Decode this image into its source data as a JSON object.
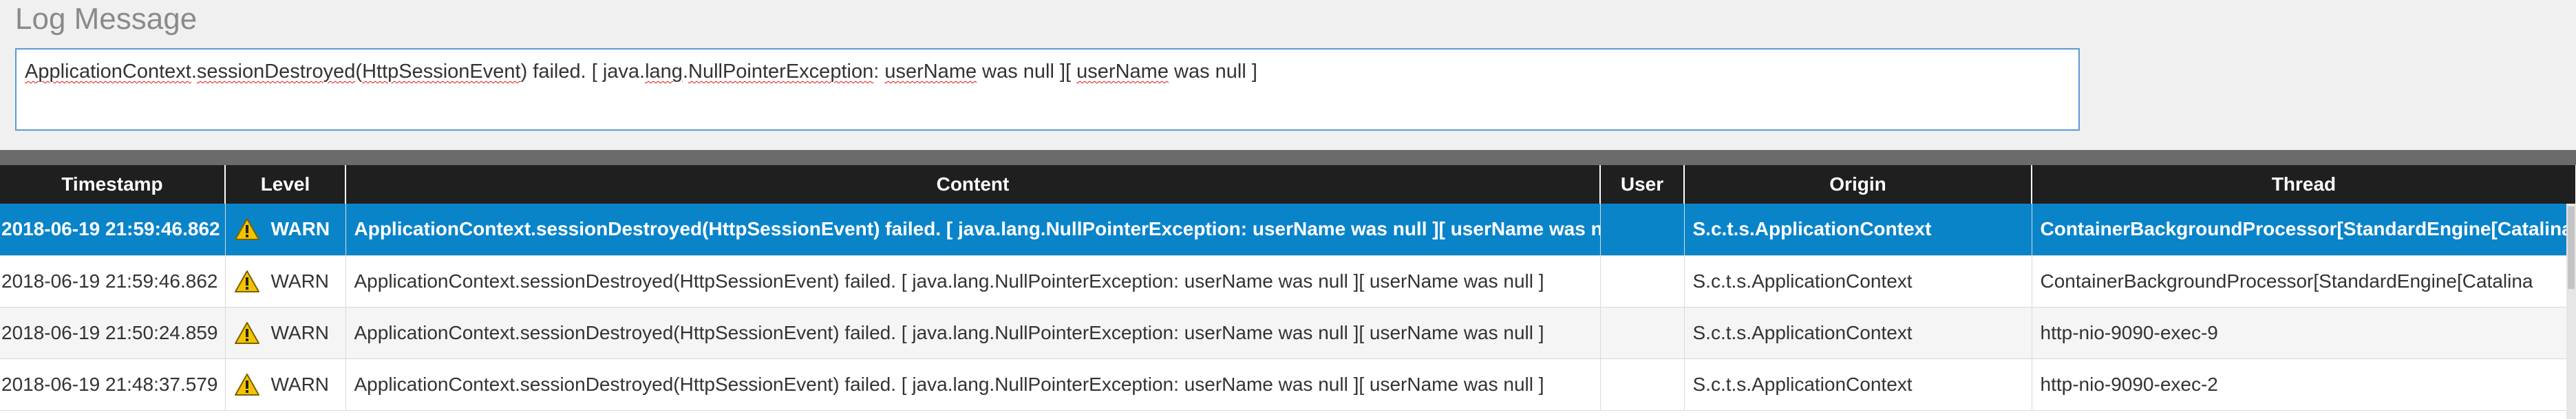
{
  "log_message": {
    "title": "Log Message",
    "text_parts": [
      {
        "t": "ApplicationContext",
        "sq": true
      },
      {
        "t": ".",
        "sq": false
      },
      {
        "t": "sessionDestroyed",
        "sq": true
      },
      {
        "t": "(",
        "sq": false
      },
      {
        "t": "HttpSessionEvent",
        "sq": true
      },
      {
        "t": ") failed. [ java.",
        "sq": false
      },
      {
        "t": "lang",
        "sq": true
      },
      {
        "t": ".",
        "sq": false
      },
      {
        "t": "NullPointerException",
        "sq": true
      },
      {
        "t": ": ",
        "sq": false
      },
      {
        "t": "userName",
        "sq": true
      },
      {
        "t": " was null ][ ",
        "sq": false
      },
      {
        "t": "userName",
        "sq": true
      },
      {
        "t": " was null ]",
        "sq": false
      }
    ]
  },
  "grid": {
    "columns": [
      "Timestamp",
      "Level",
      "Content",
      "User",
      "Origin",
      "Thread"
    ],
    "rows": [
      {
        "timestamp": "2018-06-19 21:59:46.862",
        "level": "WARN",
        "icon": "warning-icon",
        "content": "ApplicationContext.sessionDestroyed(HttpSessionEvent) failed. [ java.lang.NullPointerException: userName was null ][ userName was null ]",
        "user": "",
        "origin": "S.c.t.s.ApplicationContext",
        "thread": "ContainerBackgroundProcessor[StandardEngine[Catalina",
        "selected": true
      },
      {
        "timestamp": "2018-06-19 21:59:46.862",
        "level": "WARN",
        "icon": "warning-icon",
        "content": "ApplicationContext.sessionDestroyed(HttpSessionEvent) failed. [ java.lang.NullPointerException: userName was null ][ userName was null ]",
        "user": "",
        "origin": "S.c.t.s.ApplicationContext",
        "thread": "ContainerBackgroundProcessor[StandardEngine[Catalina",
        "selected": false
      },
      {
        "timestamp": "2018-06-19 21:50:24.859",
        "level": "WARN",
        "icon": "warning-icon",
        "content": "ApplicationContext.sessionDestroyed(HttpSessionEvent) failed. [ java.lang.NullPointerException: userName was null ][ userName was null ]",
        "user": "",
        "origin": "S.c.t.s.ApplicationContext",
        "thread": "http-nio-9090-exec-9",
        "selected": false
      },
      {
        "timestamp": "2018-06-19 21:48:37.579",
        "level": "WARN",
        "icon": "warning-icon",
        "content": "ApplicationContext.sessionDestroyed(HttpSessionEvent) failed. [ java.lang.NullPointerException: userName was null ][ userName was null ]",
        "user": "",
        "origin": "S.c.t.s.ApplicationContext",
        "thread": "http-nio-9090-exec-2",
        "selected": false
      }
    ]
  },
  "colors": {
    "selected_row": "#0a84c9",
    "header_bg": "#1f1f1f",
    "warn_yellow": "#f5c400"
  }
}
